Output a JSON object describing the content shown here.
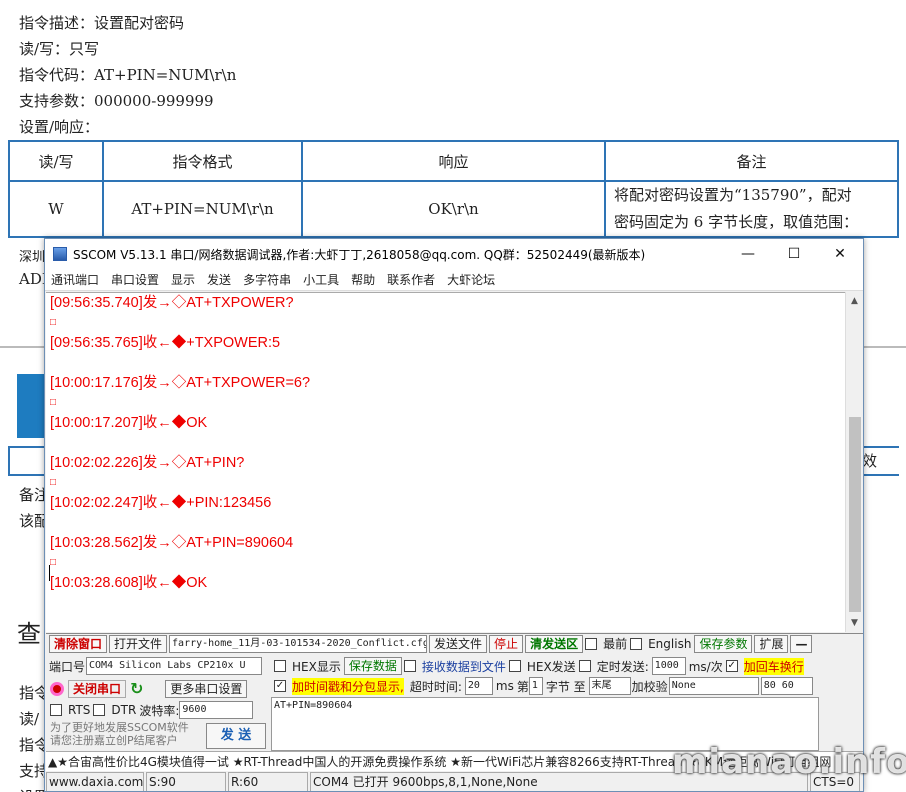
{
  "doc": {
    "lines": [
      "指令描述：设置配对密码",
      "读/写：只写",
      "指令代码：AT+PIN=NUM\\r\\n",
      "支持参数：000000-999999",
      "设置/响应："
    ],
    "table": {
      "headers": [
        "读/写",
        "指令格式",
        "响应",
        "备注"
      ],
      "row": [
        "W",
        "AT+PIN=NUM\\r\\n",
        "OK\\r\\n"
      ],
      "note_lines": [
        "将配对密码设置为“135790”，配对",
        "密码固定为 6 字节长度，取值范围："
      ]
    },
    "frag_left": [
      "深圳",
      "ADD"
    ],
    "frag_left2": [
      "备注",
      "该配"
    ],
    "big_char": "查",
    "frag_left3": [
      "指令",
      "读/",
      "指令",
      "支持",
      "设置"
    ],
    "right_frag": "效"
  },
  "window": {
    "title": "SSCOM V5.13.1 串口/网络数据调试器,作者:大虾丁丁,2618058@qq.com. QQ群：52502449(最新版本)",
    "controls": [
      "—",
      "☐",
      "✕"
    ],
    "menu": [
      "通讯端口",
      "串口设置",
      "显示",
      "发送",
      "多字符串",
      "小工具",
      "帮助",
      "联系作者",
      "大虾论坛"
    ],
    "log": [
      {
        "text": "[09:56:35.740]发→◇AT+TXPOWER?"
      },
      {
        "text": "□",
        "box": true
      },
      {
        "text": "[09:56:35.765]收←◆+TXPOWER:5"
      },
      {
        "text": ""
      },
      {
        "text": "[10:00:17.176]发→◇AT+TXPOWER=6?"
      },
      {
        "text": "□",
        "box": true
      },
      {
        "text": "[10:00:17.207]收←◆OK"
      },
      {
        "text": ""
      },
      {
        "text": "[10:02:02.226]发→◇AT+PIN?"
      },
      {
        "text": "□",
        "box": true
      },
      {
        "text": "[10:02:02.247]收←◆+PIN:123456"
      },
      {
        "text": ""
      },
      {
        "text": "[10:03:28.562]发→◇AT+PIN=890604"
      },
      {
        "text": "□",
        "box": true
      },
      {
        "text": "[10:03:28.608]收←◆OK"
      }
    ],
    "row1": {
      "clear_window": "清除窗口",
      "open_file": "打开文件",
      "file_path": "farry-home_11月-03-101534-2020_Conflict.cfg",
      "send_file": "发送文件",
      "stop": "停止",
      "clear_send": "清发送区",
      "topmost": "最前",
      "english": "English",
      "save_params": "保存参数",
      "expand": "扩展",
      "collapse": "—"
    },
    "port": {
      "label": "端口号",
      "value": "COM4 Silicon Labs CP210x U",
      "close_port": "关闭串口",
      "more_settings": "更多串口设置",
      "rts": "RTS",
      "dtr": "DTR",
      "baud_label": "波特率:",
      "baud": "9600",
      "promo": [
        "为了更好地发展SSCOM软件",
        "请您注册嘉立创P结尾客户"
      ],
      "send": "发 送"
    },
    "options": {
      "hex_display": "HEX显示",
      "save_data": "保存数据",
      "recv_to_file": "接收数据到文件",
      "hex_send": "HEX发送",
      "timed_send": "定时发送:",
      "interval": "1000",
      "interval_unit": "ms/次",
      "add_crlf": "加回车换行",
      "timestamp": "加时间戳和分包显示,",
      "timeout_label": "超时时间:",
      "timeout": "20",
      "timeout_unit": "ms",
      "byte_label_1": "第",
      "byte_index": "1",
      "byte_label_2": "字节 至",
      "byte_end": "末尾",
      "checksum_label": "加校验",
      "checksum": "None",
      "check_value": "80 60"
    },
    "send_text": "AT+PIN=890604",
    "adbar": "▲★合宙高性价比4G模块值得一试 ★RT-Thread中国人的开源免费操作系统 ★新一代WiFi芯片兼容8266支持RT-Thread ★8KM远距离WiFi可自组网",
    "status": {
      "site": "www.daxia.com",
      "sent": "S:90",
      "recv": "R:60",
      "port_state": "COM4 已打开  9600bps,8,1,None,None",
      "cts": "CTS=0"
    }
  },
  "watermark": "mianao.info"
}
